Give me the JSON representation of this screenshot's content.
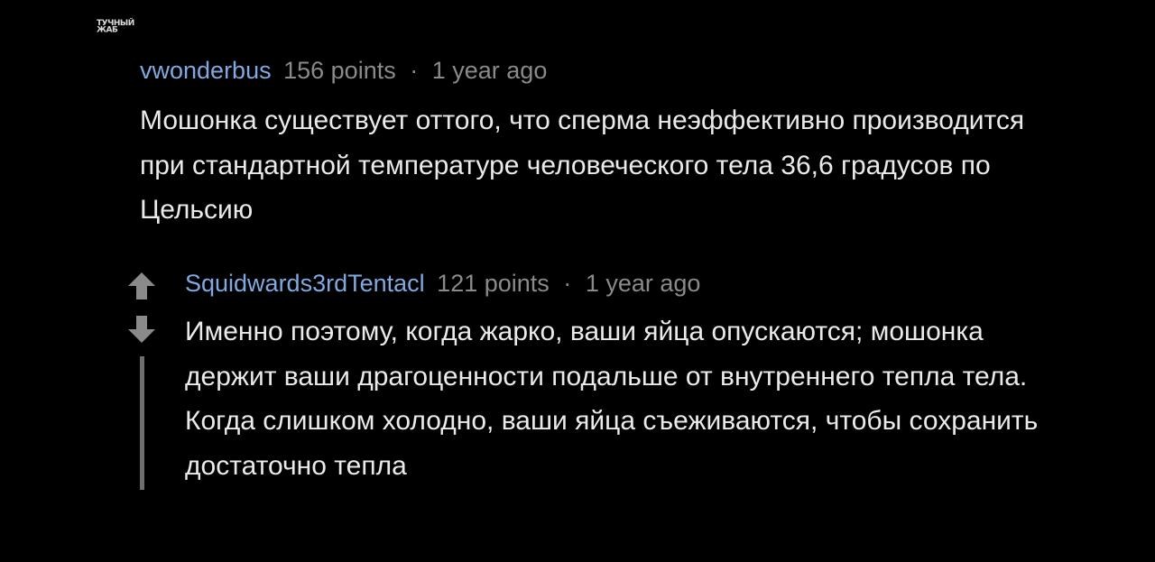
{
  "watermark": {
    "line1": "ТУЧНЫЙ",
    "line2": "ЖАБ"
  },
  "comments": [
    {
      "author": "vwonderbus",
      "points": "156 points",
      "separator": "·",
      "age": "1 year ago",
      "text": "Мошонка существует оттого, что сперма неэффективно производится при стандартной температуре человеческого тела 36,6 градусов по Цельсию"
    },
    {
      "author": "Squidwards3rdTentacl",
      "points": "121 points",
      "separator": "·",
      "age": "1 year ago",
      "text": "Именно поэтому, когда жарко, ваши яйца опускаются; мошонка держит ваши драгоценности подальше от внутреннего тепла тела. Когда слишком холодно, ваши яйца съеживаются, чтобы сохранить достаточно тепла"
    }
  ],
  "icons": {
    "upvote": "arrow-up-icon",
    "downvote": "arrow-down-icon"
  },
  "colors": {
    "background": "#000000",
    "author": "#7fa9e0",
    "meta": "#8a8a8a",
    "text": "#eaeaea",
    "thread_line": "#6e6e6e"
  }
}
